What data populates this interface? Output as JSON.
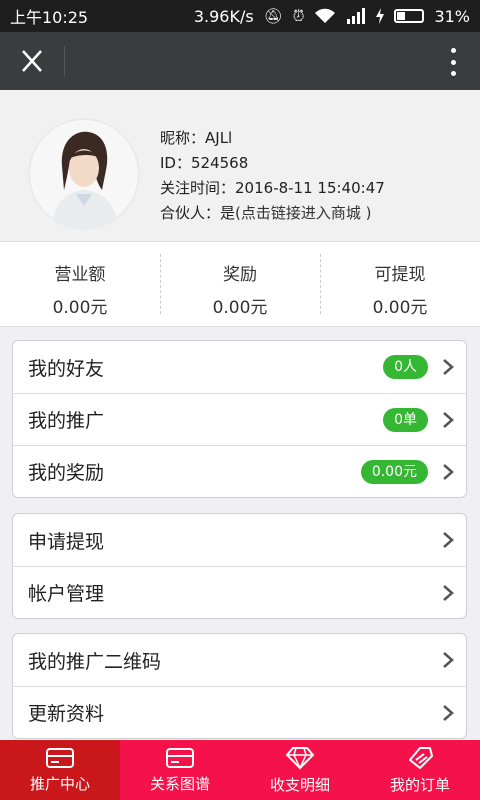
{
  "status_bar": {
    "time": "上午10:25",
    "speed": "3.96K/s",
    "battery": "31%"
  },
  "profile": {
    "nickname_label": "昵称：",
    "nickname": "AJLl",
    "id_label": "ID：",
    "id": "524568",
    "follow_label": "关注时间：",
    "follow_time": "2016-8-11 15:40:47",
    "partner_label": "合伙人：",
    "partner_value": "是",
    "partner_link": "(点击链接进入商城 )"
  },
  "stats": [
    {
      "label": "营业额",
      "value": "0.00元"
    },
    {
      "label": "奖励",
      "value": "0.00元"
    },
    {
      "label": "可提现",
      "value": "0.00元"
    }
  ],
  "menu": {
    "group1": [
      {
        "label": "我的好友",
        "badge": "0人"
      },
      {
        "label": "我的推广",
        "badge": "0单"
      },
      {
        "label": "我的奖励",
        "badge": "0.00元"
      }
    ],
    "group2": [
      {
        "label": "申请提现"
      },
      {
        "label": "帐户管理"
      }
    ],
    "group3": [
      {
        "label": "我的推广二维码"
      },
      {
        "label": "更新资料"
      }
    ]
  },
  "bottom_nav": [
    {
      "label": "推广中心",
      "icon": "card-icon",
      "active": true
    },
    {
      "label": "关系图谱",
      "icon": "card-icon",
      "active": false
    },
    {
      "label": "收支明细",
      "icon": "diamond-icon",
      "active": false
    },
    {
      "label": "我的订单",
      "icon": "tag-icon",
      "active": false
    }
  ],
  "colors": {
    "badge_green": "#35b734",
    "nav_red": "#f5124a",
    "nav_active": "#c9171c",
    "appbar": "#3b3c3e"
  }
}
